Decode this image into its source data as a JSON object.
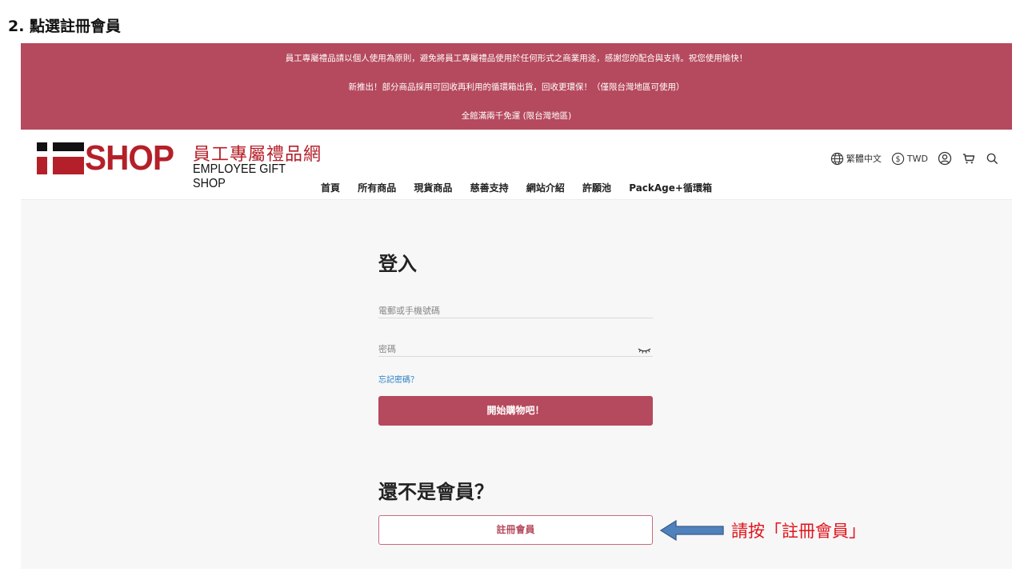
{
  "slide": {
    "title": "2. 點選註冊會員"
  },
  "announcement": {
    "line1": "員工專屬禮品請以個人使用為原則，避免將員工專屬禮品使用於任何形式之商業用途，感謝您的配合與支持。祝您使用愉快！",
    "line2": "新推出！部分商品採用可回收再利用的循環箱出貨，回收更環保！（僅限台灣地區可使用）",
    "line3": "全館滿兩千免運 (限台灣地區)"
  },
  "logo": {
    "brand": "SHOP",
    "cn": "員工專屬禮品網",
    "en": "EMPLOYEE GIFT SHOP"
  },
  "tools": {
    "language": "繁體中文",
    "currency": "TWD"
  },
  "nav": [
    "首頁",
    "所有商品",
    "現貨商品",
    "慈善支持",
    "網站介紹",
    "許願池",
    "PackAge+循環箱"
  ],
  "login": {
    "title": "登入",
    "account_placeholder": "電郵或手機號碼",
    "password_placeholder": "密碼",
    "forgot": "忘記密碼？",
    "submit": "開始購物吧！"
  },
  "register": {
    "title": "還不是會員？",
    "button": "註冊會員"
  },
  "annotation": {
    "text": "請按「註冊會員」"
  },
  "colors": {
    "brand": "#b5495d",
    "logo_red": "#b42029",
    "link": "#2a7ec4",
    "callout": "#e0141c",
    "arrow": "#4f81bd"
  }
}
